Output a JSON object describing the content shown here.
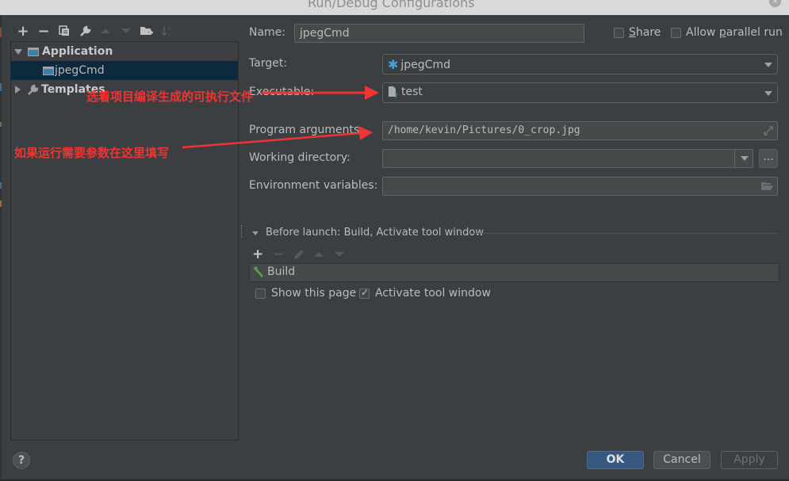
{
  "window": {
    "title": "Run/Debug Configurations",
    "close_icon": "close-icon"
  },
  "toolbar": {
    "buttons": [
      {
        "name": "add",
        "icon": "plus-icon",
        "glyph": "+",
        "enabled": true
      },
      {
        "name": "remove",
        "icon": "minus-icon",
        "glyph": "−",
        "enabled": true
      },
      {
        "name": "copy",
        "icon": "copy-icon",
        "enabled": true
      },
      {
        "name": "edit-defaults",
        "icon": "wrench-icon",
        "enabled": true
      },
      {
        "name": "move-up",
        "icon": "arrow-up-icon",
        "enabled": false
      },
      {
        "name": "move-down",
        "icon": "arrow-down-icon",
        "enabled": false
      },
      {
        "name": "new-folder",
        "icon": "folder-add-icon",
        "enabled": true
      },
      {
        "name": "sort",
        "icon": "sort-alpha-icon",
        "enabled": false
      }
    ]
  },
  "tree": {
    "application": {
      "label": "Application",
      "expanded": true
    },
    "selected_item": {
      "label": "jpegCmd"
    },
    "templates": {
      "label": "Templates",
      "expanded": false
    }
  },
  "form": {
    "name_label": "Name:",
    "name_value": "jpegCmd",
    "share_label_pre": "",
    "share_label_u": "S",
    "share_label_post": "hare",
    "share_checked": false,
    "parallel_label_pre": "Allow ",
    "parallel_label_u": "p",
    "parallel_label_post": "arallel run",
    "parallel_checked": false,
    "target_label": "Target:",
    "target_value": "jpegCmd",
    "executable_label": "Executable:",
    "executable_value": "test",
    "program_args_label": "Program arguments:",
    "program_args_value": "/home/kevin/Pictures/0_crop.jpg",
    "working_dir_label": "Working directory:",
    "working_dir_value": "",
    "browse_label": "...",
    "env_vars_label": "Environment variables:",
    "env_vars_value": ""
  },
  "before_launch": {
    "title": "Before launch: Build, Activate tool window",
    "items": [
      {
        "label": "Build",
        "icon": "hammer-icon"
      }
    ],
    "show_page_label": "Show this page",
    "show_page_checked": false,
    "activate_label": "Activate tool window",
    "activate_checked": true
  },
  "footer": {
    "help_label": "?",
    "ok_label": "OK",
    "cancel_label": "Cancel",
    "apply_label": "Apply"
  },
  "annotations": {
    "executable_note": "选着项目编译生成的可执行文件",
    "args_note": "如果运行需要参数在这里填写",
    "color": "#f03434"
  }
}
